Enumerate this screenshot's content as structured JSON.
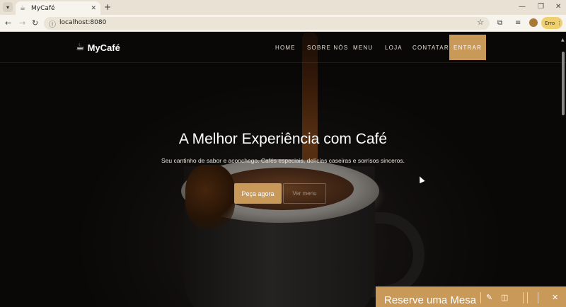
{
  "browser": {
    "tab_title": "MyCafé",
    "url": "localhost:8080",
    "new_tab_symbol": "+",
    "profile_status": "Erro",
    "icons": [
      "chevron-down-icon",
      "coffee-favicon",
      "close-icon",
      "back-icon",
      "forward-icon",
      "reload-icon",
      "info-icon",
      "star-icon",
      "extensions-icon",
      "media-icon",
      "menu-icon"
    ]
  },
  "site": {
    "brand": "MyCafé",
    "nav": {
      "home": "HOME",
      "sobre": "SOBRE NÓS",
      "menu": "MENU",
      "loja": "LOJA",
      "contatar": "CONTATAR",
      "entrar": "ENTRAR"
    },
    "hero": {
      "title": "A Melhor Experiência com Café",
      "subtitle": "Seu cantinho de sabor e aconchego. Cafés especiais, delícias caseiras e sorrisos sinceros.",
      "primary_cta": "Peça agora",
      "secondary_cta": "Ver menu"
    },
    "reserve": {
      "title": "Reserve uma Mesa"
    },
    "colors": {
      "accent": "#c9995a",
      "overlay": "#000000"
    }
  }
}
